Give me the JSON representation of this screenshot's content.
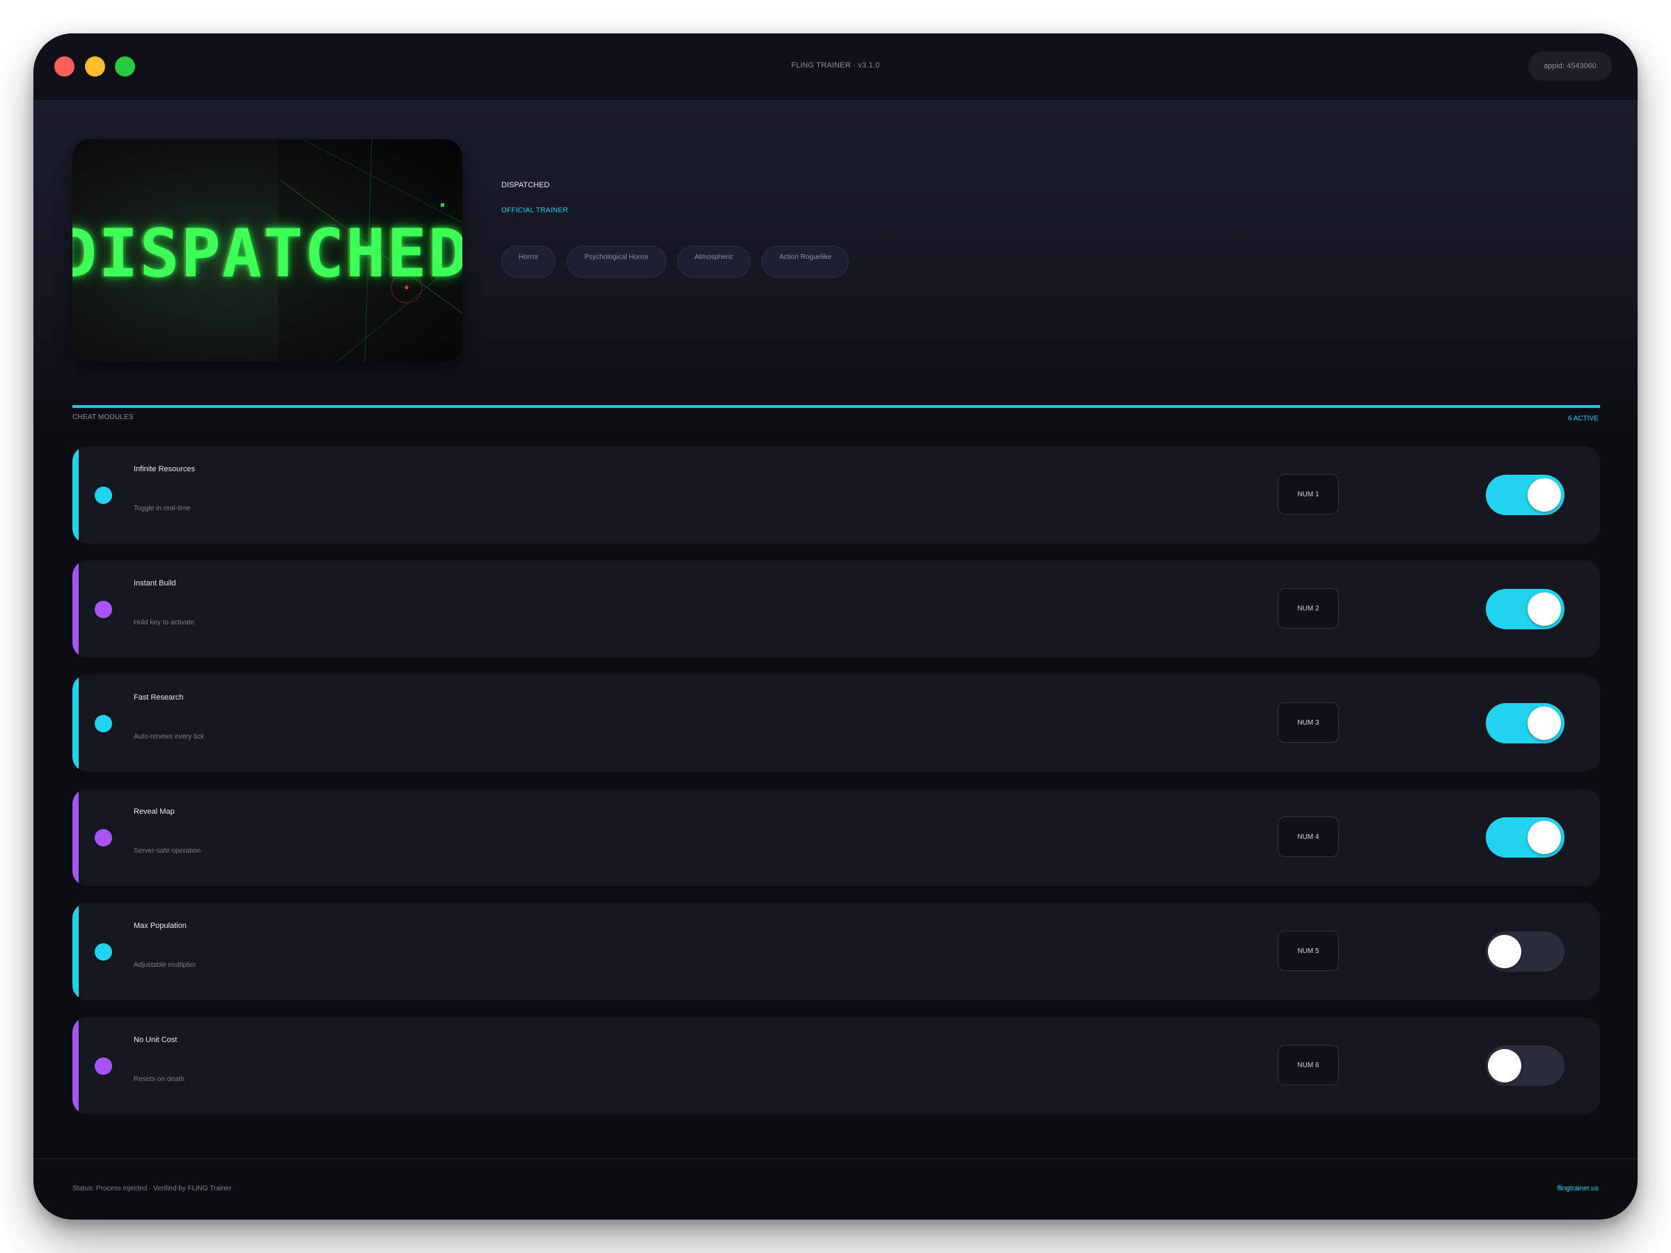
{
  "window": {
    "title": "FLiNG TRAINER · v3.1.0",
    "appid": "appid: 4543060"
  },
  "game": {
    "cover_text": "DISPATCHED",
    "name": "DISPATCHED",
    "badge": "OFFICIAL TRAINER",
    "tags": [
      "Horror",
      "Psychological Horror",
      "Atmospheric",
      "Action Roguelike"
    ]
  },
  "section": {
    "label": "CHEAT MODULES",
    "active_count": "6 ACTIVE"
  },
  "colors": {
    "accent_cyan": "#22d3ee",
    "accent_purple": "#a855f7"
  },
  "cheats": [
    {
      "name": "Infinite Resources",
      "description": "Toggle in real-time",
      "key": "NUM 1",
      "accent": "#22d3ee",
      "enabled": true
    },
    {
      "name": "Instant Build",
      "description": "Hold key to activate",
      "key": "NUM 2",
      "accent": "#a855f7",
      "enabled": true
    },
    {
      "name": "Fast Research",
      "description": "Auto-renews every tick",
      "key": "NUM 3",
      "accent": "#22d3ee",
      "enabled": true
    },
    {
      "name": "Reveal Map",
      "description": "Server-safe operation",
      "key": "NUM 4",
      "accent": "#a855f7",
      "enabled": true
    },
    {
      "name": "Max Population",
      "description": "Adjustable multiplier",
      "key": "NUM 5",
      "accent": "#22d3ee",
      "enabled": false
    },
    {
      "name": "No Unit Cost",
      "description": "Resets on death",
      "key": "NUM 6",
      "accent": "#a855f7",
      "enabled": false
    }
  ],
  "footer": {
    "status": "Status: Process injected · Verified by FLiNG Trainer",
    "site": "flingtrainer.us"
  }
}
